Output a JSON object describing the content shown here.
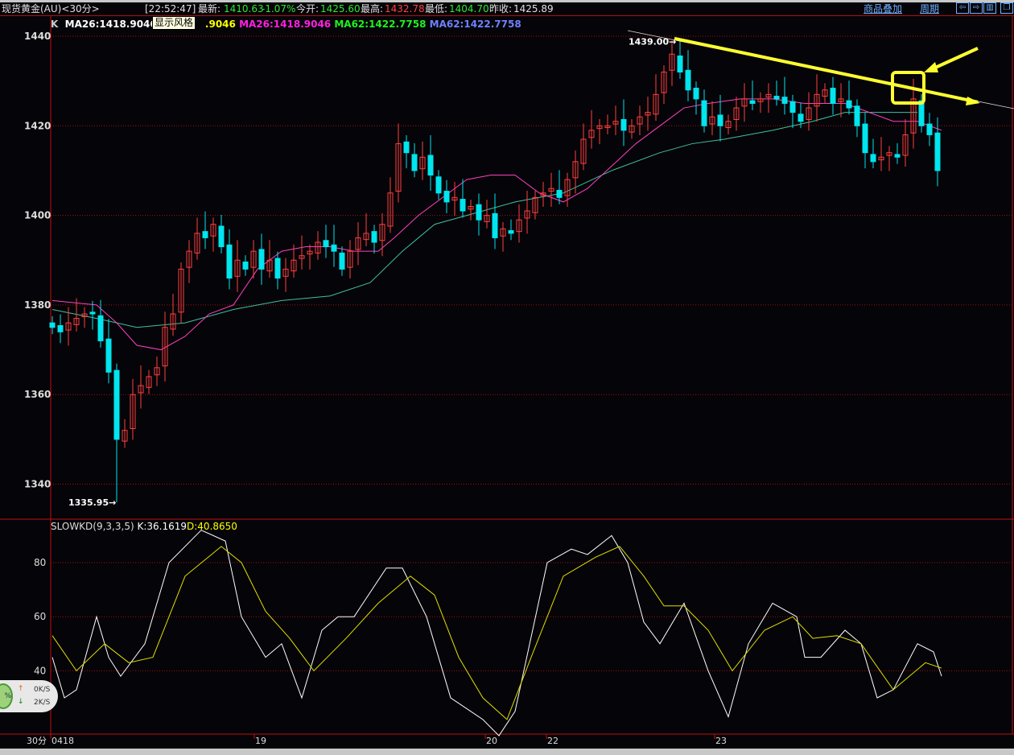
{
  "header": {
    "title": "现货黄金(AU)<30分>",
    "time": "[22:52:47]",
    "last_label": "最新:",
    "last": "1410.63",
    "change": "-1.07%",
    "open_label": "今开:",
    "open": "1425.60",
    "high_label": "最高:",
    "high": "1432.78",
    "low_label": "最低:",
    "low": "1404.70",
    "prev_label": "昨收:",
    "prev": "1425.89",
    "overlay_link": "商品叠加",
    "period_link": "周期",
    "btn_left": "⇦",
    "btn_right": "⇨",
    "btn_panel": "▥",
    "btn_window": "❐"
  },
  "legend": {
    "k": "K",
    "ma26a": "MA26:1418.9046",
    "ma_hidden": "M",
    ".tail": "",
    "tail": ".9046",
    "ma26b": "MA26:1418.9046",
    "ma62a": "MA62:1422.7758",
    "ma62b": "MA62:1422.7758"
  },
  "tooltip": "显示风格",
  "kd_legend": {
    "name": "SLOWKD(9,3,3,5)",
    "k": "K:36.1619",
    "d": "D:40.8650"
  },
  "net": {
    "pct": "%",
    "up": "0K/S",
    "down": "2K/S"
  },
  "colors": {
    "up": "#ff4040",
    "down": "#00e5ee",
    "ma26": "#ff40c0",
    "ma62": "#40c0a0",
    "k": "#ffffff",
    "d": "#e0e000",
    "grid": "#a01010",
    "trend": "#ffff30"
  },
  "chart_data": [
    {
      "type": "candlestick",
      "title": "现货黄金(AU) 30分",
      "ylim": [
        1330,
        1445
      ],
      "yticks": [
        1340,
        1360,
        1380,
        1400,
        1420,
        1440
      ],
      "xticks": [
        {
          "bar": 0,
          "label": "0418"
        },
        {
          "bar": 25.3,
          "label": "19"
        },
        {
          "bar": 54,
          "label": "20"
        },
        {
          "bar": 61.6,
          "label": "22"
        },
        {
          "bar": 82.5,
          "label": "23"
        }
      ],
      "x_axis_unit": "30分",
      "closes": [
        1375,
        1374,
        1376,
        1377,
        1378,
        1378,
        1372,
        1365,
        1350,
        1352,
        1360,
        1362,
        1364,
        1366,
        1375,
        1378,
        1388,
        1392,
        1396,
        1395,
        1398,
        1393,
        1386,
        1390,
        1388,
        1392,
        1388,
        1390,
        1386,
        1388,
        1390,
        1391,
        1392,
        1394,
        1393,
        1392,
        1388,
        1392,
        1395,
        1396,
        1394,
        1398,
        1405,
        1416,
        1414,
        1410,
        1413,
        1409,
        1405,
        1403,
        1404,
        1401,
        1402,
        1399,
        1400,
        1395,
        1397,
        1396,
        1399,
        1401,
        1404,
        1405,
        1406,
        1404,
        1408,
        1412,
        1417,
        1419,
        1420,
        1420,
        1421,
        1419,
        1420,
        1422,
        1423,
        1427,
        1432,
        1436,
        1432,
        1428,
        1426,
        1420,
        1422,
        1420,
        1421,
        1424,
        1426,
        1425,
        1426,
        1427,
        1426,
        1425,
        1423,
        1421,
        1424,
        1427,
        1428,
        1425,
        1426,
        1424,
        1420,
        1414,
        1412,
        1413,
        1414,
        1413,
        1418,
        1426,
        1420,
        1418,
        1410
      ],
      "extremes": {
        "low": {
          "bar": 8,
          "value": 1335.95,
          "label": "1335.95"
        },
        "high": {
          "bar": 77,
          "value": 1439.0,
          "label": "1439.00"
        }
      },
      "ma26": [
        [
          0,
          1381
        ],
        [
          5.5,
          1380
        ],
        [
          8,
          1376
        ],
        [
          10.5,
          1371
        ],
        [
          13.5,
          1370
        ],
        [
          16.5,
          1373
        ],
        [
          19.5,
          1378
        ],
        [
          22.5,
          1380
        ],
        [
          25.5,
          1388
        ],
        [
          28.5,
          1392
        ],
        [
          31.5,
          1393
        ],
        [
          34.5,
          1393
        ],
        [
          37.5,
          1392
        ],
        [
          40.5,
          1392
        ],
        [
          42.5,
          1395
        ],
        [
          45.5,
          1400
        ],
        [
          48.5,
          1404
        ],
        [
          51.5,
          1408
        ],
        [
          54.5,
          1409
        ],
        [
          57.5,
          1409
        ],
        [
          60.5,
          1405
        ],
        [
          63.5,
          1403
        ],
        [
          66.5,
          1406
        ],
        [
          69.5,
          1411
        ],
        [
          72.5,
          1416
        ],
        [
          75.5,
          1420
        ],
        [
          78.5,
          1424
        ],
        [
          81.5,
          1425
        ],
        [
          85.5,
          1426
        ],
        [
          89.5,
          1426
        ],
        [
          93.5,
          1425
        ],
        [
          98.5,
          1425
        ],
        [
          101.5,
          1423
        ],
        [
          104.5,
          1421
        ],
        [
          107.5,
          1421
        ],
        [
          110.5,
          1419
        ]
      ],
      "ma62": [
        [
          0,
          1379
        ],
        [
          5.5,
          1377
        ],
        [
          10.5,
          1375
        ],
        [
          16.5,
          1376
        ],
        [
          22.5,
          1379
        ],
        [
          28.5,
          1381
        ],
        [
          34.5,
          1382
        ],
        [
          39.5,
          1385
        ],
        [
          43.5,
          1392
        ],
        [
          47.5,
          1398
        ],
        [
          51.5,
          1400
        ],
        [
          57.5,
          1403
        ],
        [
          63.5,
          1405
        ],
        [
          69.5,
          1410
        ],
        [
          75.5,
          1414
        ],
        [
          79.5,
          1416
        ],
        [
          83.5,
          1417
        ],
        [
          89.5,
          1419
        ],
        [
          94.5,
          1421
        ],
        [
          98.5,
          1423
        ],
        [
          103.5,
          1423
        ],
        [
          107.5,
          1423
        ]
      ],
      "trendline": [
        [
          77.3,
          1439.5
        ],
        [
          115,
          1425.3
        ]
      ]
    },
    {
      "type": "line",
      "title": "SLOWKD(9,3,3,5)",
      "ylim": [
        15,
        95
      ],
      "yticks": [
        40,
        60,
        80
      ],
      "series": [
        {
          "name": "K",
          "values": [
            [
              0,
              45
            ],
            [
              1.5,
              30
            ],
            [
              3,
              33
            ],
            [
              5.5,
              60
            ],
            [
              7,
              45
            ],
            [
              8.5,
              38
            ],
            [
              11.5,
              50
            ],
            [
              14.5,
              80
            ],
            [
              18.5,
              92
            ],
            [
              21.5,
              88
            ],
            [
              23.5,
              60
            ],
            [
              26.5,
              45
            ],
            [
              28.5,
              50
            ],
            [
              31,
              30
            ],
            [
              33.5,
              55
            ],
            [
              35.5,
              60
            ],
            [
              37.5,
              60
            ],
            [
              41.5,
              78
            ],
            [
              43.5,
              78
            ],
            [
              46.5,
              60
            ],
            [
              49.5,
              30
            ],
            [
              53.5,
              22
            ],
            [
              55.5,
              16
            ],
            [
              57.5,
              25
            ],
            [
              61.5,
              80
            ],
            [
              64.5,
              85
            ],
            [
              66.5,
              83
            ],
            [
              69.5,
              90
            ],
            [
              71.5,
              80
            ],
            [
              73.5,
              58
            ],
            [
              75.5,
              50
            ],
            [
              78.5,
              65
            ],
            [
              81.5,
              40
            ],
            [
              84,
              23
            ],
            [
              86.5,
              50
            ],
            [
              89.5,
              65
            ],
            [
              92.5,
              60
            ],
            [
              93.5,
              45
            ],
            [
              95.5,
              45
            ],
            [
              98.5,
              55
            ],
            [
              100.5,
              50
            ],
            [
              102.5,
              30
            ],
            [
              104.5,
              33
            ],
            [
              107.5,
              50
            ],
            [
              109.5,
              47
            ],
            [
              110.5,
              38
            ]
          ]
        },
        {
          "name": "D",
          "values": [
            [
              0,
              53
            ],
            [
              3,
              40
            ],
            [
              6.5,
              50
            ],
            [
              9.5,
              43
            ],
            [
              12.5,
              45
            ],
            [
              16.5,
              75
            ],
            [
              21,
              86
            ],
            [
              23.5,
              80
            ],
            [
              26.5,
              62
            ],
            [
              29.5,
              52
            ],
            [
              32.5,
              40
            ],
            [
              36.5,
              52
            ],
            [
              40.5,
              65
            ],
            [
              44.5,
              75
            ],
            [
              47.5,
              68
            ],
            [
              50.5,
              45
            ],
            [
              53.5,
              30
            ],
            [
              56.5,
              22
            ],
            [
              59.5,
              45
            ],
            [
              63.5,
              75
            ],
            [
              67.5,
              82
            ],
            [
              70.5,
              86
            ],
            [
              73.5,
              75
            ],
            [
              76,
              64
            ],
            [
              78.5,
              64
            ],
            [
              81.5,
              55
            ],
            [
              84.5,
              40
            ],
            [
              88.5,
              55
            ],
            [
              92,
              60
            ],
            [
              94.5,
              52
            ],
            [
              97.5,
              53
            ],
            [
              100.5,
              50
            ],
            [
              104.5,
              33
            ],
            [
              108.5,
              43
            ],
            [
              110.5,
              41
            ]
          ]
        }
      ]
    }
  ]
}
